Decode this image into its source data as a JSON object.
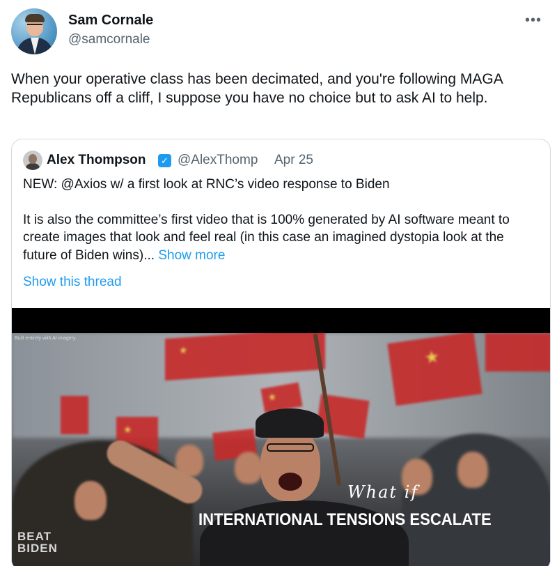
{
  "tweet": {
    "author_name": "Sam Cornale",
    "author_handle": "@samcornale",
    "more_icon": "•••",
    "text": "When your operative class has been decimated, and you're following MAGA Republicans off a cliff, I suppose you have no choice but to ask AI to help."
  },
  "quote": {
    "author_name": "Alex Thompson",
    "verified_icon": "verified-badge",
    "author_handle": "@AlexThomp",
    "date": "Apr 25",
    "paragraph1": "NEW: @Axios w/ a first look at RNC’s video response to Biden",
    "paragraph2": "It is also the committee’s first video that is 100% generated by AI software meant to create images that look and feel real (in this case an imagined dystopia look  at the future of Biden wins)...",
    "show_more_label": "Show more",
    "show_thread_label": "Show this thread"
  },
  "video": {
    "watermark": "Built entirely with AI imagery.",
    "overlay_what_if": "What if",
    "overlay_headline": "INTERNATIONAL TENSIONS ESCALATE",
    "logo_line1": "BEAT",
    "logo_line2": "BIDEN"
  }
}
